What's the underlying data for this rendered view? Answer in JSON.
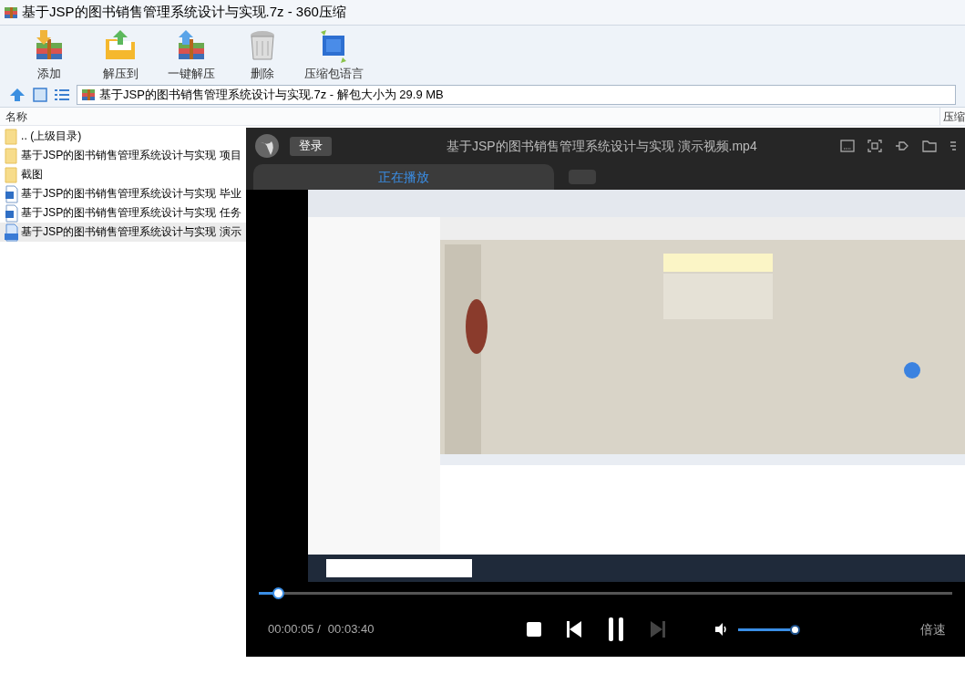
{
  "window": {
    "title": "基于JSP的图书销售管理系统设计与实现.7z - 360压缩"
  },
  "toolbar": [
    {
      "kind": "add",
      "label": "添加"
    },
    {
      "kind": "extract",
      "label": "解压到"
    },
    {
      "kind": "oneclick",
      "label": "一键解压"
    },
    {
      "kind": "delete",
      "label": "删除"
    },
    {
      "kind": "language",
      "label": "压缩包语言"
    }
  ],
  "address_bar": {
    "value": "基于JSP的图书销售管理系统设计与实现.7z - 解包大小为 29.9 MB"
  },
  "file_list": {
    "columns": [
      "名称",
      "压缩"
    ],
    "rows": [
      {
        "kind": "folder",
        "name": ".. (上级目录)",
        "selected": false
      },
      {
        "kind": "folder",
        "name": "基于JSP的图书销售管理系统设计与实现 项目",
        "selected": false
      },
      {
        "kind": "folder",
        "name": "截图",
        "selected": false
      },
      {
        "kind": "word",
        "name": "基于JSP的图书销售管理系统设计与实现 毕业",
        "selected": false
      },
      {
        "kind": "word",
        "name": "基于JSP的图书销售管理系统设计与实现 任务",
        "selected": false
      },
      {
        "kind": "mp4",
        "name": "基于JSP的图书销售管理系统设计与实现 演示",
        "selected": true
      }
    ]
  },
  "player": {
    "login": "登录",
    "title": "基于JSP的图书销售管理系统设计与实现 演示视频.mp4",
    "tabs": [
      {
        "label": "正在播放",
        "selected": true
      },
      {
        "selected": false
      }
    ],
    "seek": {
      "level": 0.027
    },
    "elapsed": "00:00:05 /",
    "duration": "00:03:40",
    "playing": true,
    "volume": {
      "level": 1
    },
    "speed": "倍速"
  }
}
